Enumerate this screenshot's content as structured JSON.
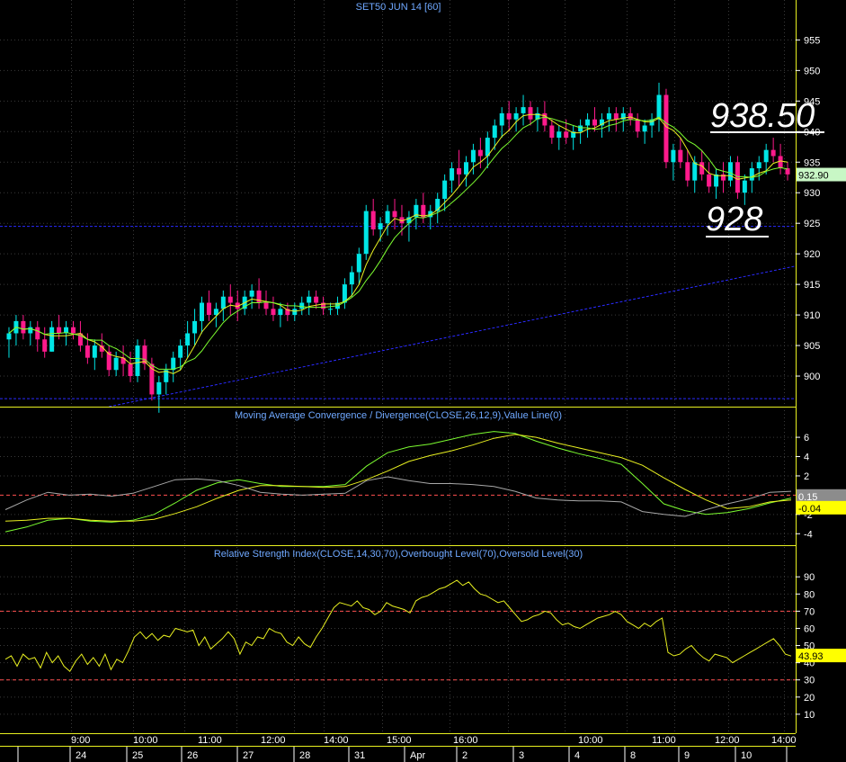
{
  "chart_data": [
    {
      "panel": "price",
      "type": "candlestick",
      "title": "SET50 JUN 14   [60]",
      "ylim": [
        895,
        958
      ],
      "yticks": [
        900,
        905,
        910,
        915,
        920,
        925,
        930,
        935,
        940,
        945,
        950,
        955
      ],
      "last_price_label": "932.90",
      "annotations": [
        "938.50",
        "928"
      ],
      "horizontal_lines": [
        924.5,
        896.3
      ],
      "trendline": {
        "from": [
          0,
          895
        ],
        "to": [
          125,
          918
        ]
      },
      "colors": {
        "up": "#00e5e5",
        "down": "#ff1a8c",
        "ma_fast": "#e8f020",
        "ma_slow": "#7cfc30",
        "guide": "#2a2aff"
      },
      "candles": [
        [
          906,
          908,
          903,
          907
        ],
        [
          907,
          910,
          905,
          909
        ],
        [
          909,
          910,
          906,
          907
        ],
        [
          907,
          909,
          905,
          908
        ],
        [
          908,
          909,
          904,
          906
        ],
        [
          906,
          908,
          903,
          904
        ],
        [
          904,
          909,
          904,
          908
        ],
        [
          908,
          910,
          906,
          907
        ],
        [
          907,
          909,
          905,
          908
        ],
        [
          908,
          909,
          906,
          907
        ],
        [
          907,
          909,
          904,
          905
        ],
        [
          905,
          907,
          902,
          903
        ],
        [
          903,
          906,
          901,
          905
        ],
        [
          905,
          907,
          903,
          904
        ],
        [
          904,
          905,
          900,
          901
        ],
        [
          901,
          904,
          900,
          903
        ],
        [
          903,
          905,
          900,
          902
        ],
        [
          902,
          904,
          899,
          900
        ],
        [
          900,
          906,
          899,
          905
        ],
        [
          905,
          906,
          901,
          902
        ],
        [
          902,
          903,
          896,
          897
        ],
        [
          897,
          900,
          894,
          899
        ],
        [
          899,
          902,
          897,
          901
        ],
        [
          901,
          904,
          899,
          903
        ],
        [
          903,
          906,
          901,
          905
        ],
        [
          905,
          909,
          903,
          907
        ],
        [
          907,
          911,
          905,
          909
        ],
        [
          909,
          913,
          907,
          912
        ],
        [
          912,
          914,
          909,
          910
        ],
        [
          910,
          912,
          908,
          911
        ],
        [
          911,
          914,
          909,
          913
        ],
        [
          913,
          915,
          910,
          912
        ],
        [
          912,
          914,
          909,
          911
        ],
        [
          911,
          914,
          910,
          913
        ],
        [
          913,
          915,
          911,
          914
        ],
        [
          914,
          916,
          911,
          912
        ],
        [
          912,
          914,
          910,
          911
        ],
        [
          911,
          913,
          909,
          910
        ],
        [
          910,
          912,
          908,
          911
        ],
        [
          911,
          912,
          909,
          910
        ],
        [
          910,
          912,
          909,
          911
        ],
        [
          911,
          913,
          910,
          912
        ],
        [
          912,
          914,
          910,
          913
        ],
        [
          913,
          914,
          911,
          912
        ],
        [
          912,
          913,
          910,
          911
        ],
        [
          911,
          912,
          910,
          911
        ],
        [
          911,
          913,
          910,
          912
        ],
        [
          912,
          916,
          911,
          915
        ],
        [
          915,
          918,
          913,
          917
        ],
        [
          917,
          921,
          915,
          920
        ],
        [
          920,
          928,
          919,
          927
        ],
        [
          927,
          929,
          923,
          924
        ],
        [
          924,
          926,
          922,
          925
        ],
        [
          925,
          928,
          923,
          927
        ],
        [
          927,
          929,
          924,
          926
        ],
        [
          926,
          928,
          923,
          925
        ],
        [
          925,
          927,
          922,
          926
        ],
        [
          926,
          929,
          924,
          928
        ],
        [
          928,
          930,
          925,
          926
        ],
        [
          926,
          928,
          924,
          927
        ],
        [
          927,
          930,
          925,
          929
        ],
        [
          929,
          933,
          927,
          932
        ],
        [
          932,
          935,
          930,
          934
        ],
        [
          934,
          937,
          931,
          933
        ],
        [
          933,
          936,
          931,
          935
        ],
        [
          935,
          938,
          933,
          937
        ],
        [
          937,
          939,
          934,
          936
        ],
        [
          936,
          940,
          934,
          939
        ],
        [
          939,
          942,
          937,
          941
        ],
        [
          941,
          944,
          939,
          943
        ],
        [
          943,
          945,
          940,
          942
        ],
        [
          942,
          944,
          940,
          943
        ],
        [
          943,
          946,
          941,
          944
        ],
        [
          944,
          945,
          941,
          942
        ],
        [
          942,
          944,
          940,
          943
        ],
        [
          943,
          945,
          940,
          941
        ],
        [
          941,
          942,
          938,
          939
        ],
        [
          939,
          941,
          937,
          940
        ],
        [
          940,
          942,
          938,
          939
        ],
        [
          939,
          941,
          937,
          940
        ],
        [
          940,
          942,
          938,
          941
        ],
        [
          941,
          943,
          939,
          942
        ],
        [
          942,
          944,
          940,
          941
        ],
        [
          941,
          943,
          939,
          942
        ],
        [
          942,
          944,
          940,
          943
        ],
        [
          943,
          944,
          940,
          942
        ],
        [
          942,
          944,
          940,
          943
        ],
        [
          943,
          944,
          941,
          942
        ],
        [
          942,
          943,
          939,
          940
        ],
        [
          940,
          942,
          938,
          941
        ],
        [
          941,
          943,
          939,
          942
        ],
        [
          942,
          948,
          940,
          946
        ],
        [
          946,
          947,
          934,
          935
        ],
        [
          935,
          938,
          932,
          937
        ],
        [
          937,
          939,
          934,
          935
        ],
        [
          935,
          937,
          931,
          932
        ],
        [
          932,
          936,
          930,
          935
        ],
        [
          935,
          937,
          932,
          933
        ],
        [
          933,
          935,
          930,
          931
        ],
        [
          931,
          934,
          929,
          933
        ],
        [
          933,
          935,
          930,
          932
        ],
        [
          932,
          936,
          931,
          935
        ],
        [
          935,
          936,
          929,
          930
        ],
        [
          930,
          933,
          928,
          932
        ],
        [
          932,
          935,
          930,
          934
        ],
        [
          934,
          936,
          932,
          935
        ],
        [
          935,
          938,
          933,
          937
        ],
        [
          937,
          939,
          935,
          936
        ],
        [
          936,
          938,
          933,
          934
        ],
        [
          934,
          935,
          932,
          933
        ]
      ]
    },
    {
      "panel": "macd",
      "type": "line",
      "title": "Moving Average Convergence / Divergence(CLOSE,26,12,9),Value Line(0)",
      "ylim": [
        -5,
        7.5
      ],
      "yticks": [
        -4,
        -2,
        2,
        4,
        6
      ],
      "zero_level_label": "0",
      "value_labels": [
        "0.15",
        "-0.04"
      ],
      "series": [
        {
          "color": "#7cfc30",
          "values": [
            -3.8,
            -3.3,
            -2.6,
            -2.4,
            -2.7,
            -2.8,
            -2.6,
            -2.0,
            -0.8,
            0.5,
            1.3,
            1.6,
            1.2,
            0.9,
            0.9,
            0.9,
            1.1,
            3.0,
            4.4,
            5.0,
            5.3,
            5.8,
            6.3,
            6.6,
            6.4,
            5.6,
            4.9,
            4.3,
            3.8,
            3.2,
            1.2,
            -0.9,
            -1.6,
            -2.0,
            -1.8,
            -1.4,
            -0.8,
            -0.3
          ]
        },
        {
          "color": "#e8f020",
          "values": [
            -2.7,
            -2.6,
            -2.4,
            -2.4,
            -2.6,
            -2.7,
            -2.7,
            -2.5,
            -1.9,
            -1.2,
            -0.3,
            0.5,
            1.0,
            1.0,
            0.9,
            0.8,
            0.9,
            1.6,
            2.5,
            3.5,
            4.1,
            4.6,
            5.2,
            5.9,
            6.3,
            6.0,
            5.4,
            4.9,
            4.4,
            3.9,
            3.1,
            1.8,
            0.6,
            -0.5,
            -1.4,
            -1.2,
            -0.7,
            -0.5
          ]
        },
        {
          "color": "#a8a8a8",
          "values": [
            -1.5,
            -0.5,
            0.3,
            0.0,
            0.1,
            -0.1,
            0.2,
            0.9,
            1.6,
            1.7,
            1.5,
            1.0,
            0.3,
            0.1,
            0.0,
            0.1,
            0.2,
            1.5,
            1.9,
            1.5,
            1.2,
            1.2,
            1.1,
            0.9,
            0.4,
            -0.3,
            -0.5,
            -0.6,
            -0.6,
            -0.7,
            -1.7,
            -2.0,
            -2.2,
            -1.5,
            -0.9,
            -0.4,
            0.3,
            0.4
          ]
        }
      ]
    },
    {
      "panel": "rsi",
      "type": "line",
      "title": "Relative Strength Index(CLOSE,14,30,70),Overbought Level(70),Oversold Level(30)",
      "ylim": [
        0,
        99
      ],
      "yticks": [
        10,
        20,
        30,
        40,
        50,
        60,
        70,
        80,
        90
      ],
      "levels": [
        70,
        30
      ],
      "value_label": "43.93",
      "series": [
        {
          "color": "#e8f020",
          "values": [
            42,
            44,
            38,
            45,
            42,
            43,
            37,
            46,
            40,
            44,
            38,
            35,
            41,
            45,
            39,
            43,
            38,
            45,
            36,
            42,
            40,
            47,
            55,
            58,
            54,
            57,
            53,
            56,
            55,
            60,
            59,
            58,
            59,
            50,
            55,
            48,
            51,
            54,
            58,
            54,
            45,
            52,
            50,
            55,
            54,
            60,
            58,
            57,
            52,
            50,
            55,
            51,
            49,
            55,
            60,
            66,
            72,
            75,
            74,
            73,
            76,
            72,
            71,
            68,
            70,
            75,
            73,
            72,
            71,
            69,
            76,
            78,
            79,
            81,
            83,
            84,
            86,
            88,
            85,
            87,
            83,
            80,
            79,
            77,
            75,
            76,
            72,
            68,
            64,
            65,
            67,
            68,
            70,
            69,
            65,
            62,
            63,
            61,
            60,
            62,
            64,
            66,
            67,
            68,
            70,
            68,
            64,
            62,
            60,
            63,
            61,
            64,
            66,
            46,
            44,
            45,
            48,
            50,
            46,
            43,
            41,
            45,
            44,
            43,
            40,
            42,
            44,
            46,
            48,
            50,
            52,
            54,
            50,
            45,
            43.9
          ]
        }
      ]
    }
  ],
  "x_axis": {
    "time_labels": [
      "9:00",
      "10:00",
      "11:00",
      "12:00",
      "14:00",
      "15:00",
      "16:00",
      "10:00",
      "11:00",
      "12:00",
      "14:00"
    ],
    "day_labels": [
      "24",
      "25",
      "26",
      "27",
      "28",
      "31",
      "Apr",
      "2",
      "3",
      "4",
      "8",
      "9",
      "10"
    ]
  }
}
